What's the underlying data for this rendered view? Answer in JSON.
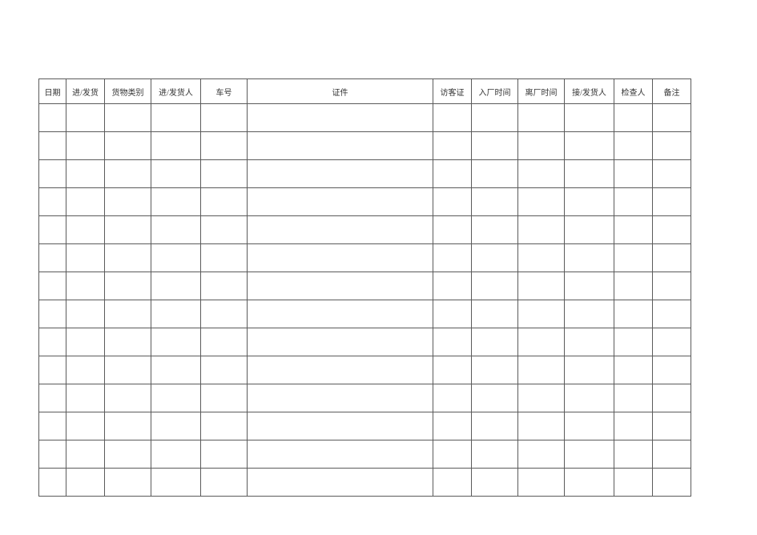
{
  "table": {
    "headers": [
      "日期",
      "进/发货",
      "货物类别",
      "进/发货人",
      "车号",
      "证件",
      "访客证",
      "入厂时间",
      "离厂时间",
      "接/发货人",
      "检查人",
      "备注"
    ],
    "row_count": 14
  }
}
